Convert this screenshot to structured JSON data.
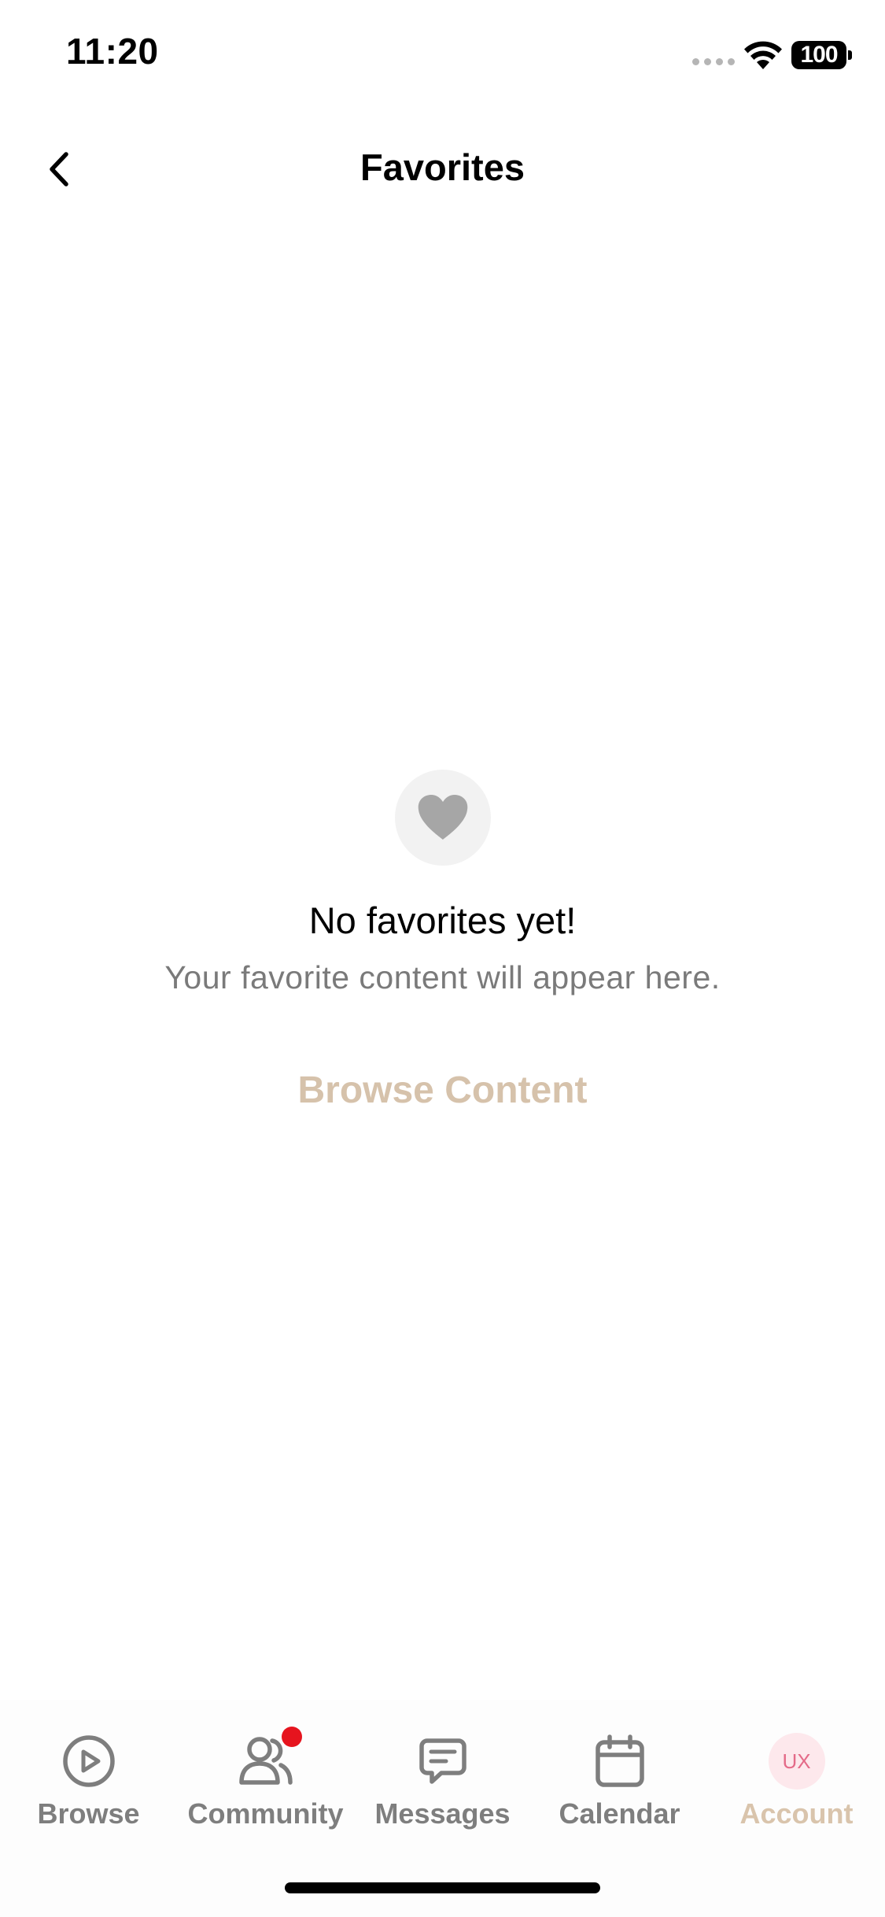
{
  "status_bar": {
    "time": "11:20",
    "battery": "100"
  },
  "nav": {
    "title": "Favorites",
    "back_icon": "chevron-left-icon"
  },
  "empty_state": {
    "icon": "heart-icon",
    "title": "No favorites yet!",
    "subtitle": "Your favorite content will appear here.",
    "action_label": "Browse Content"
  },
  "tabs": [
    {
      "label": "Browse",
      "icon": "play-circle-icon"
    },
    {
      "label": "Community",
      "icon": "people-icon",
      "has_notification": true
    },
    {
      "label": "Messages",
      "icon": "chat-bubble-icon"
    },
    {
      "label": "Calendar",
      "icon": "calendar-icon"
    },
    {
      "label": "Account",
      "icon": "avatar",
      "avatar_initials": "UX",
      "active": true
    }
  ],
  "colors": {
    "accent": "#d6c2ab",
    "inactive_tab": "#7e7e7e",
    "notification": "#e6141e",
    "avatar_bg": "#fde8ec",
    "avatar_text": "#e46a88"
  }
}
